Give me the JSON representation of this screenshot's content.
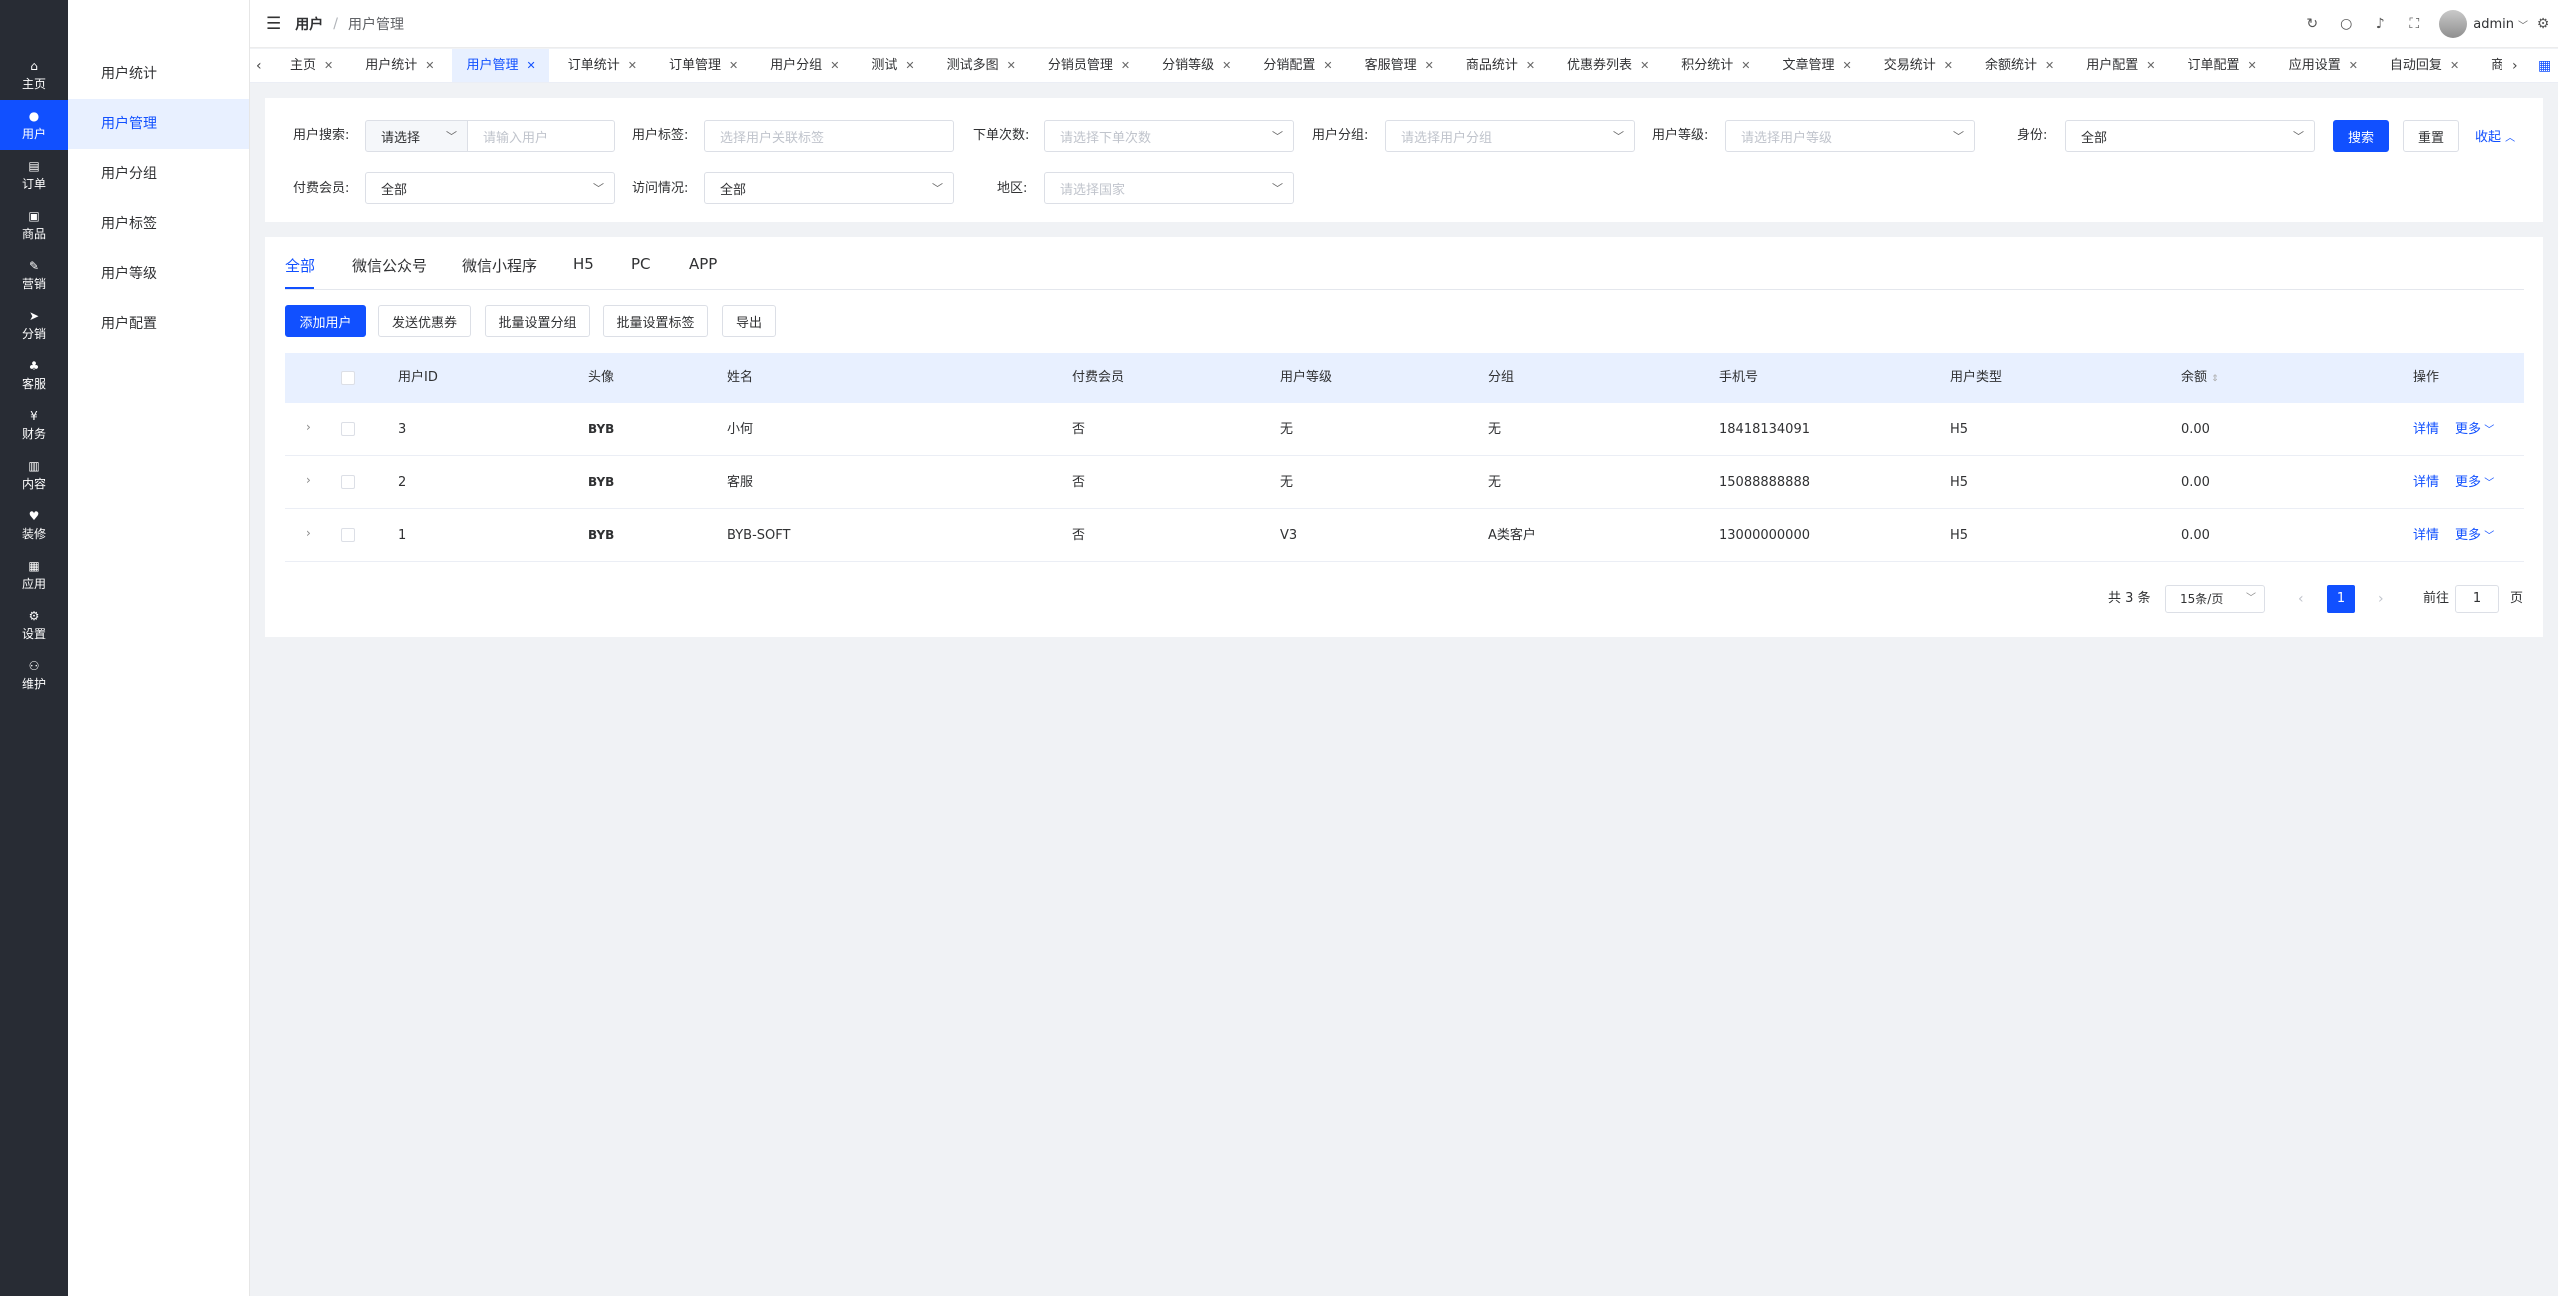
{
  "rail": {
    "items": [
      {
        "label": "主页",
        "icon": "home-icon",
        "glyph": "⌂"
      },
      {
        "label": "用户",
        "icon": "user-icon",
        "glyph": "●"
      },
      {
        "label": "订单",
        "icon": "order-icon",
        "glyph": "▤"
      },
      {
        "label": "商品",
        "icon": "goods-icon",
        "glyph": "▣"
      },
      {
        "label": "营销",
        "icon": "marketing-icon",
        "glyph": "✎"
      },
      {
        "label": "分销",
        "icon": "distribution-icon",
        "glyph": "➤"
      },
      {
        "label": "客服",
        "icon": "service-icon",
        "glyph": "♣"
      },
      {
        "label": "财务",
        "icon": "finance-icon",
        "glyph": "¥"
      },
      {
        "label": "内容",
        "icon": "content-icon",
        "glyph": "▥"
      },
      {
        "label": "装修",
        "icon": "decoration-icon",
        "glyph": "♥"
      },
      {
        "label": "应用",
        "icon": "apps-icon",
        "glyph": "▦"
      },
      {
        "label": "设置",
        "icon": "settings-icon",
        "glyph": "⚙"
      },
      {
        "label": "维护",
        "icon": "maintenance-icon",
        "glyph": "⚇"
      }
    ]
  },
  "submenu": {
    "items": [
      "用户统计",
      "用户管理",
      "用户分组",
      "用户标签",
      "用户等级",
      "用户配置"
    ]
  },
  "header": {
    "breadcrumb_root": "用户",
    "breadcrumb_sep": "/",
    "breadcrumb_current": "用户管理",
    "username": "admin"
  },
  "tabs": [
    "主页",
    "用户统计",
    "用户管理",
    "订单统计",
    "订单管理",
    "用户分组",
    "测试",
    "测试多图",
    "分销员管理",
    "分销等级",
    "分销配置",
    "客服管理",
    "商品统计",
    "优惠券列表",
    "积分统计",
    "文章管理",
    "交易统计",
    "余额统计",
    "用户配置",
    "订单配置",
    "应用设置",
    "自动回复",
    "商"
  ],
  "filter": {
    "search_label": "用户搜索:",
    "search_select": "请选择",
    "search_placeholder": "请输入用户",
    "tag_label": "用户标签:",
    "tag_placeholder": "选择用户关联标签",
    "orders_label": "下单次数:",
    "orders_placeholder": "请选择下单次数",
    "group_label": "用户分组:",
    "group_placeholder": "请选择用户分组",
    "level_label": "用户等级:",
    "level_placeholder": "请选择用户等级",
    "identity_label": "身份:",
    "identity_value": "全部",
    "search_btn": "搜索",
    "reset_btn": "重置",
    "collapse": "收起",
    "paid_label": "付费会员:",
    "paid_value": "全部",
    "visit_label": "访问情况:",
    "visit_value": "全部",
    "region_label": "地区:",
    "region_placeholder": "请选择国家"
  },
  "platform_tabs": [
    "全部",
    "微信公众号",
    "微信小程序",
    "H5",
    "PC",
    "APP"
  ],
  "actions": {
    "add": "添加用户",
    "coupon": "发送优惠券",
    "batch_group": "批量设置分组",
    "batch_tag": "批量设置标签",
    "export": "导出"
  },
  "table": {
    "headers": {
      "id": "用户ID",
      "avatar": "头像",
      "name": "姓名",
      "paid": "付费会员",
      "level": "用户等级",
      "group": "分组",
      "phone": "手机号",
      "type": "用户类型",
      "balance": "余额",
      "ops": "操作"
    },
    "rows": [
      {
        "id": "3",
        "avatar": "BYB",
        "name": "小何",
        "paid": "否",
        "level": "无",
        "group": "无",
        "phone": "18418134091",
        "type": "H5",
        "balance": "0.00",
        "detail": "详情",
        "more": "更多"
      },
      {
        "id": "2",
        "avatar": "BYB",
        "name": "客服",
        "paid": "否",
        "level": "无",
        "group": "无",
        "phone": "15088888888",
        "type": "H5",
        "balance": "0.00",
        "detail": "详情",
        "more": "更多"
      },
      {
        "id": "1",
        "avatar": "BYB",
        "name": "BYB-SOFT",
        "paid": "否",
        "level": "V3",
        "group": "A类客户",
        "phone": "13000000000",
        "type": "H5",
        "balance": "0.00",
        "detail": "详情",
        "more": "更多"
      }
    ]
  },
  "pagination": {
    "total": "共 3 条",
    "page_size": "15条/页",
    "current": "1",
    "goto": "前往",
    "goto_value": "1",
    "page_unit": "页"
  },
  "colors": {
    "primary": "#1150ff",
    "rail": "#282c34",
    "header_row": "#e8f0ff"
  }
}
